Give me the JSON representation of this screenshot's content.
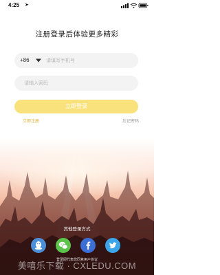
{
  "status_bar": {
    "time": "4:25",
    "location_icon": "location-arrow-icon",
    "signal_icon": "signal-icon",
    "wifi_icon": "wifi-icon",
    "battery_icon": "battery-icon"
  },
  "headline": "注册登录后体验更多精彩",
  "phone": {
    "country_code": "+86",
    "chevron_icon": "chevron-down-icon",
    "placeholder": "请填写手机号",
    "value": ""
  },
  "password": {
    "placeholder": "请输入密码",
    "value": ""
  },
  "login_button": "立即登录",
  "links": {
    "register": "立即注册",
    "forgot": "忘记密码"
  },
  "other_login": {
    "title": "其他登录方式",
    "providers": [
      {
        "name": "QQ",
        "icon": "qq-icon",
        "color": "#4a8fd8"
      },
      {
        "name": "WeChat",
        "icon": "wechat-icon",
        "color": "#5cc44a"
      },
      {
        "name": "Facebook",
        "icon": "facebook-icon",
        "color": "#3b6fd6"
      },
      {
        "name": "Twitter",
        "icon": "twitter-icon",
        "color": "#3aa5e8"
      }
    ]
  },
  "agreement": "登录即代表您同意用户协议",
  "watermark": "美嘻乐下载 · CXLEDU.COM",
  "colors": {
    "accent": "#f9e27c",
    "link": "#e2b23a"
  }
}
